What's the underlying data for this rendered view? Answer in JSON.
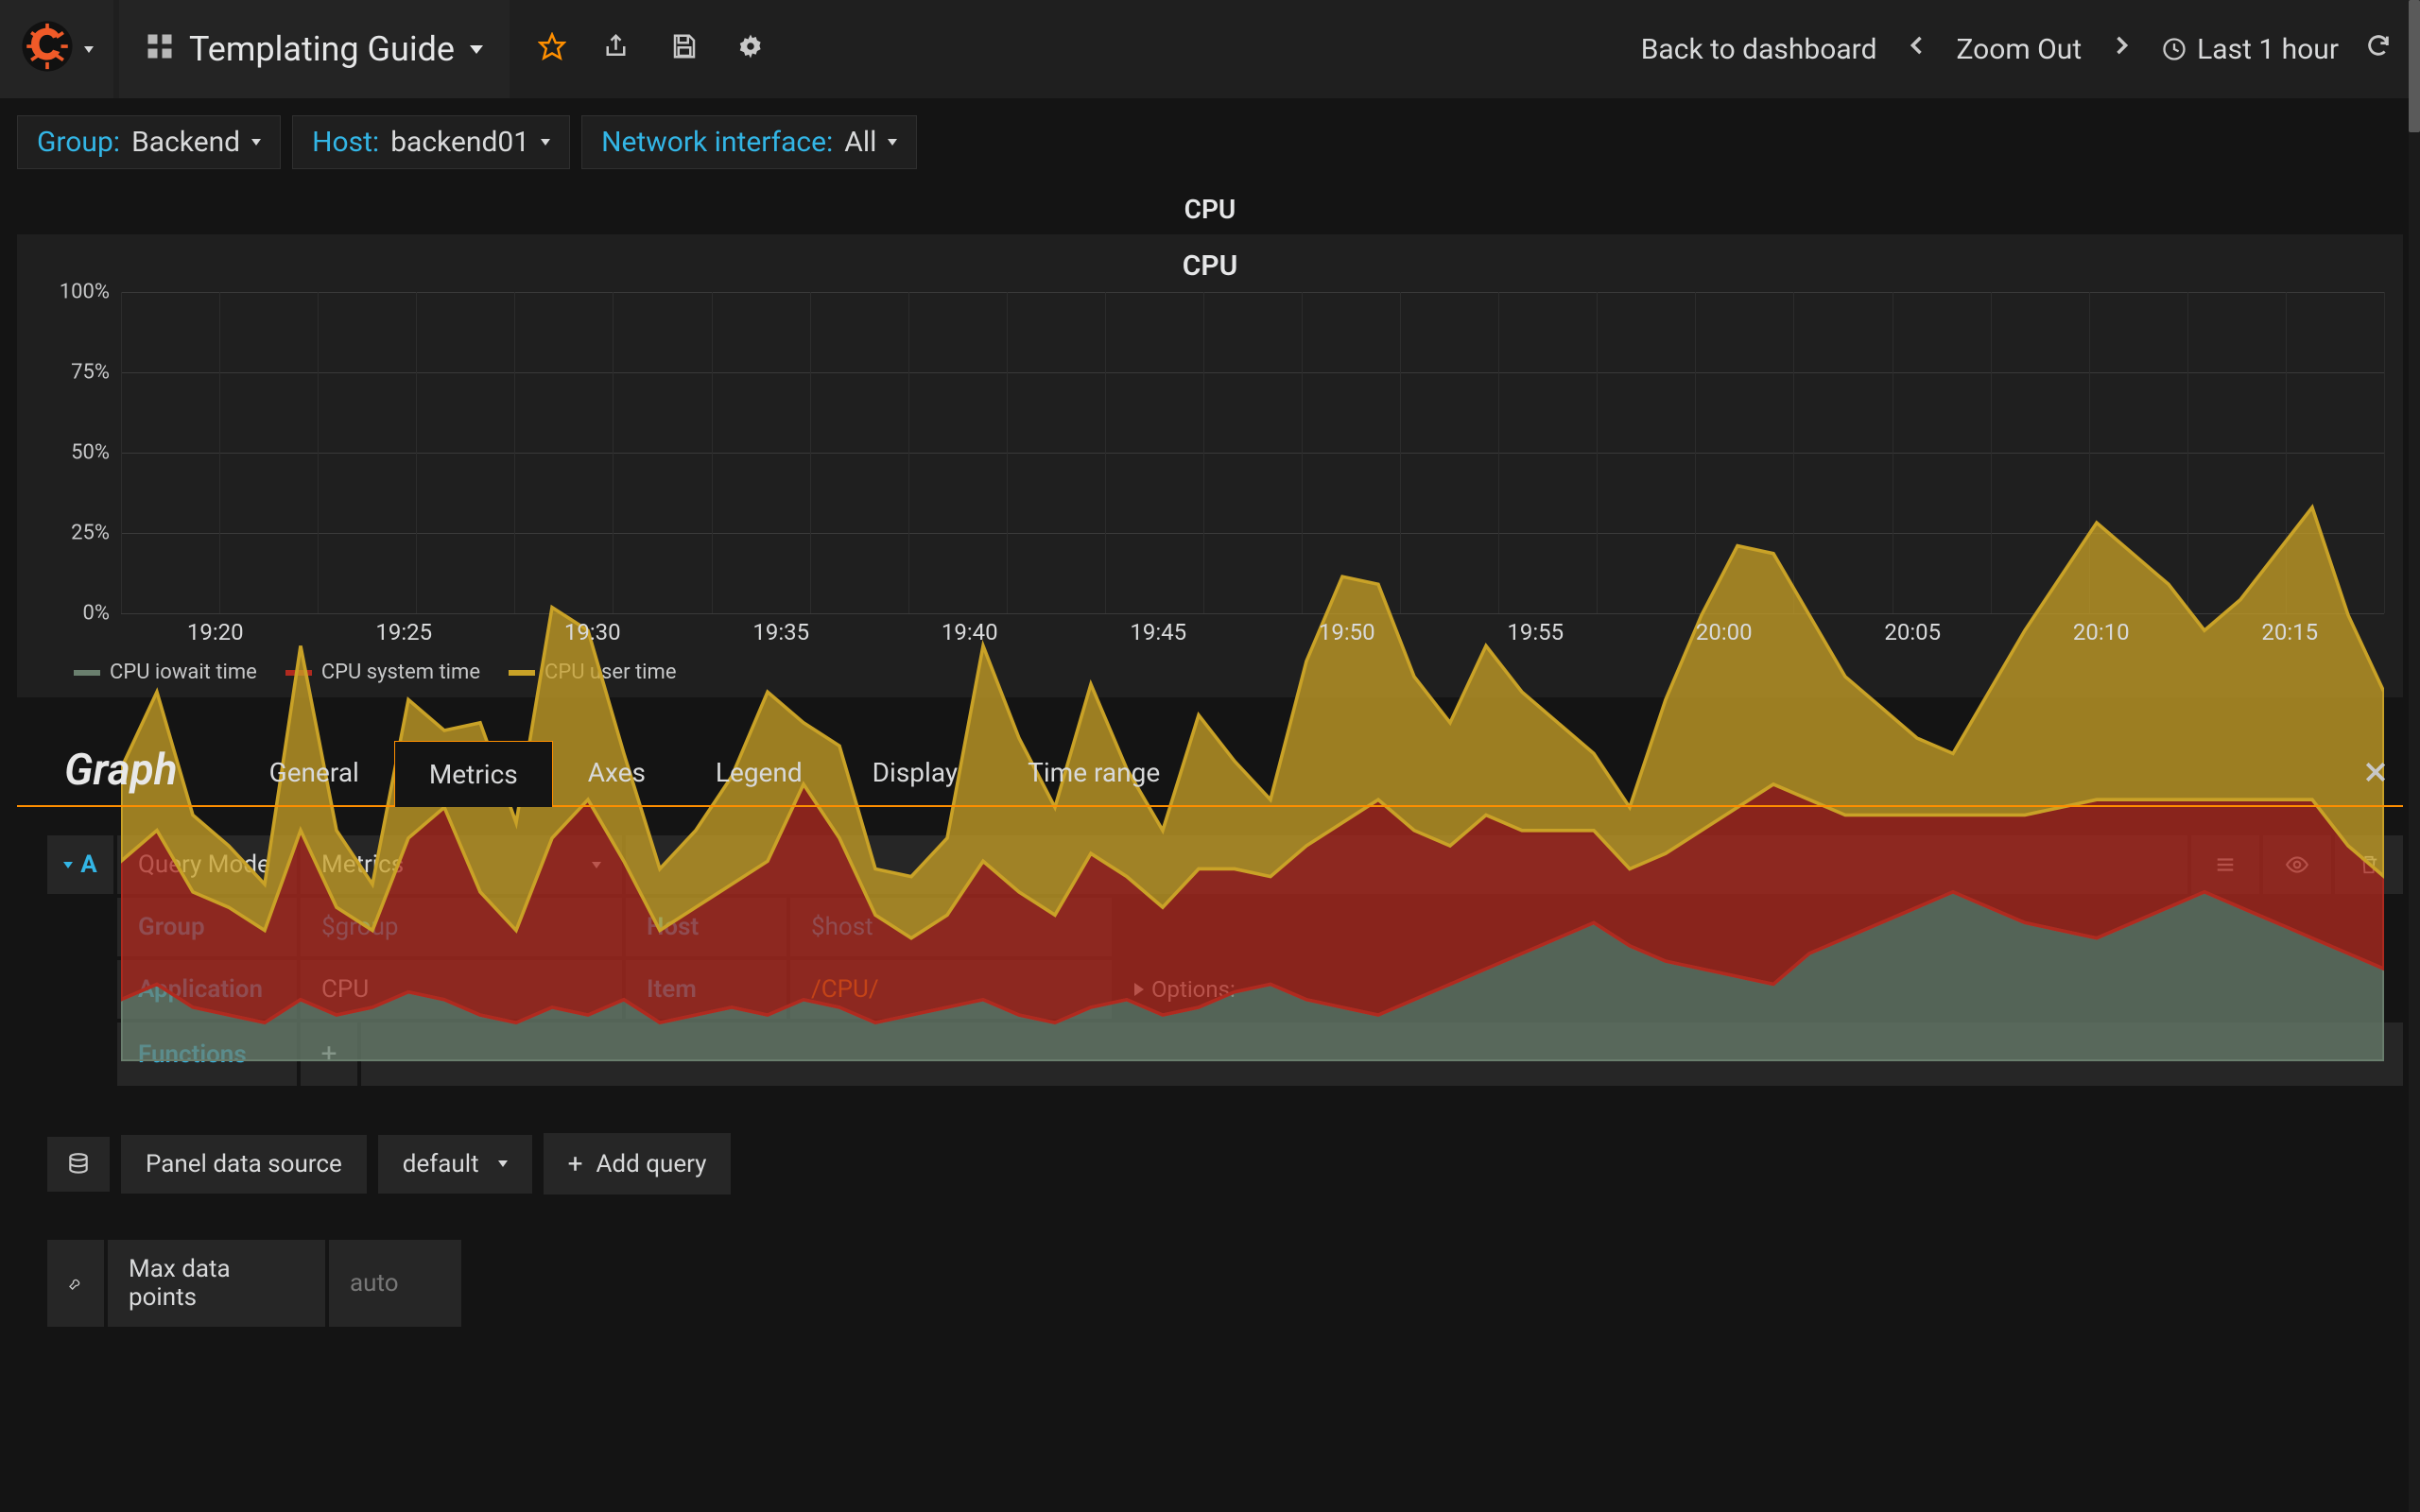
{
  "header": {
    "dashboard_title": "Templating Guide",
    "back_label": "Back to dashboard",
    "zoom_label": "Zoom Out",
    "time_label": "Last 1 hour"
  },
  "vars": [
    {
      "label": "Group:",
      "value": "Backend"
    },
    {
      "label": "Host:",
      "value": "backend01"
    },
    {
      "label": "Network interface:",
      "value": "All"
    }
  ],
  "row_title": "CPU",
  "panel": {
    "title": "CPU"
  },
  "chart_data": {
    "type": "area",
    "stacked": true,
    "ylabel": "",
    "ylim": [
      0,
      100
    ],
    "yticks": [
      "0%",
      "25%",
      "50%",
      "75%",
      "100%"
    ],
    "xticks": [
      "19:20",
      "19:25",
      "19:30",
      "19:35",
      "19:40",
      "19:45",
      "19:50",
      "19:55",
      "20:00",
      "20:05",
      "20:10",
      "20:15"
    ],
    "series": [
      {
        "name": "CPU iowait time",
        "color": "#6a7f6e",
        "values": [
          8,
          10,
          7,
          6,
          5,
          8,
          6,
          7,
          9,
          8,
          6,
          5,
          7,
          6,
          8,
          5,
          6,
          7,
          6,
          8,
          7,
          5,
          6,
          7,
          8,
          6,
          5,
          7,
          8,
          6,
          7,
          9,
          10,
          8,
          7,
          6,
          8,
          10,
          12,
          14,
          16,
          18,
          15,
          13,
          12,
          11,
          10,
          14,
          16,
          18,
          20,
          22,
          20,
          18,
          17,
          16,
          18,
          20,
          22,
          20,
          18,
          16,
          14,
          12
        ]
      },
      {
        "name": "CPU system time",
        "color": "#b02a1f",
        "values": [
          18,
          20,
          15,
          14,
          12,
          22,
          14,
          10,
          20,
          25,
          16,
          12,
          22,
          28,
          18,
          12,
          14,
          16,
          20,
          28,
          22,
          14,
          10,
          12,
          18,
          16,
          14,
          20,
          16,
          14,
          18,
          16,
          14,
          20,
          24,
          28,
          22,
          18,
          20,
          16,
          14,
          12,
          10,
          14,
          18,
          22,
          26,
          20,
          16,
          14,
          12,
          10,
          12,
          14,
          16,
          18,
          16,
          14,
          12,
          14,
          16,
          18,
          14,
          12
        ]
      },
      {
        "name": "CPU user time",
        "color": "#c9a227",
        "values": [
          12,
          18,
          10,
          8,
          6,
          24,
          10,
          6,
          18,
          10,
          22,
          14,
          30,
          22,
          14,
          8,
          10,
          14,
          22,
          8,
          12,
          6,
          8,
          10,
          28,
          20,
          14,
          22,
          14,
          10,
          20,
          14,
          10,
          24,
          32,
          28,
          20,
          16,
          22,
          18,
          14,
          10,
          8,
          20,
          28,
          34,
          30,
          24,
          18,
          14,
          10,
          8,
          16,
          24,
          30,
          36,
          32,
          28,
          22,
          26,
          32,
          38,
          30,
          24
        ]
      }
    ],
    "legend": [
      "CPU iowait time",
      "CPU system time",
      "CPU user time"
    ]
  },
  "editor": {
    "title": "Graph",
    "tabs": [
      "General",
      "Metrics",
      "Axes",
      "Legend",
      "Display",
      "Time range"
    ],
    "active_tab": "Metrics",
    "query_letter": "A",
    "query_mode_label": "Query Mode",
    "query_mode_value": "Metrics",
    "fields": {
      "group_label": "Group",
      "group_value": "$group",
      "host_label": "Host",
      "host_value": "$host",
      "app_label": "Application",
      "app_value": "CPU",
      "item_label": "Item",
      "item_value": "/CPU/",
      "func_label": "Functions",
      "options_label": "Options:"
    },
    "datasource_label": "Panel data source",
    "datasource_value": "default",
    "add_query_label": "Add query",
    "max_dp_label": "Max data points",
    "max_dp_placeholder": "auto"
  }
}
